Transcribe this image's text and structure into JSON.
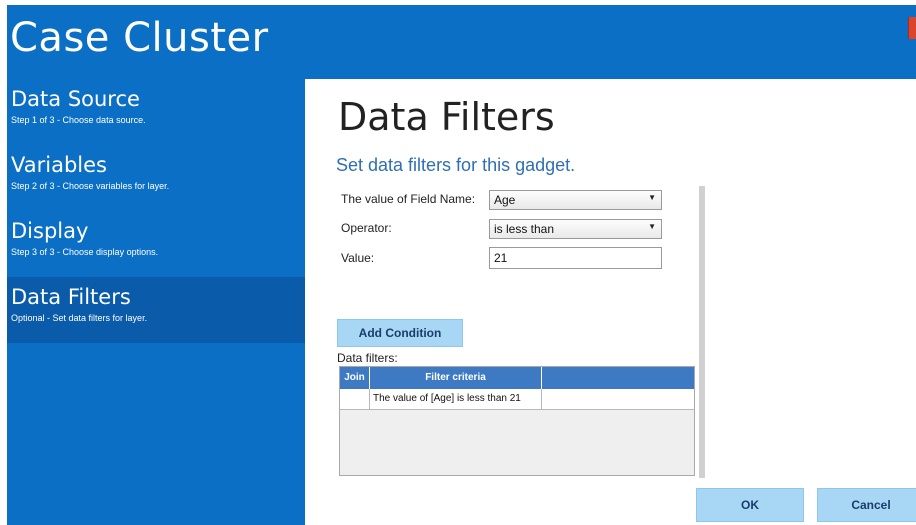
{
  "app": {
    "title": "Case Cluster"
  },
  "sidebar": {
    "items": [
      {
        "title": "Data Source",
        "subtitle": "Step 1 of 3 - Choose data source.",
        "active": false
      },
      {
        "title": "Variables",
        "subtitle": "Step 2 of 3 - Choose variables for layer.",
        "active": false
      },
      {
        "title": "Display",
        "subtitle": "Step 3 of 3 - Choose display options.",
        "active": false
      },
      {
        "title": "Data Filters",
        "subtitle": "Optional - Set data filters for layer.",
        "active": true
      }
    ]
  },
  "main": {
    "title": "Data Filters",
    "subtitle": "Set data filters for this gadget.",
    "form": {
      "field_label": "The value of Field Name:",
      "field_value": "Age",
      "operator_label": "Operator:",
      "operator_value": "is less than",
      "value_label": "Value:",
      "value_value": "21"
    },
    "add_condition_label": "Add Condition",
    "grid_label": "Data filters:",
    "grid": {
      "columns": [
        "Join",
        "Filter criteria",
        ""
      ],
      "rows": [
        [
          "",
          "The value of [Age] is less than 21",
          ""
        ]
      ]
    }
  },
  "buttons": {
    "ok": "OK",
    "cancel": "Cancel"
  },
  "colors": {
    "accent": "#0b6fc6",
    "active_item": "#0a5cab",
    "button_bg": "#a8d6f5",
    "grid_header": "#3e79c4"
  }
}
